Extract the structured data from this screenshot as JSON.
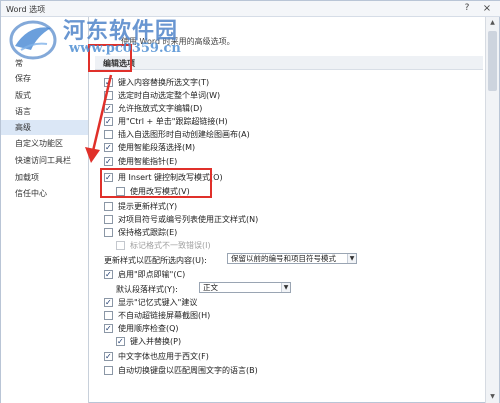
{
  "window": {
    "title": "Word 选项",
    "help_glyph": "?",
    "close_glyph": "×"
  },
  "sidebar": {
    "items": [
      {
        "label": "常"
      },
      {
        "label": "保存"
      },
      {
        "label": "版式"
      },
      {
        "label": "语言"
      },
      {
        "label": "高级",
        "selected": true
      },
      {
        "label": "自定义功能区"
      },
      {
        "label": "快速访问工具栏"
      },
      {
        "label": "加载项"
      },
      {
        "label": "信任中心"
      }
    ]
  },
  "content": {
    "intro": "使用 Word 时采用的高级选项。",
    "section_title": "编辑选项",
    "options": [
      {
        "label": "键入内容替换所选文字(T)",
        "checked": true
      },
      {
        "label": "选定时自动选定整个单词(W)",
        "checked": false
      },
      {
        "label": "允许拖放式文字编辑(D)",
        "checked": true
      },
      {
        "label": "用\"Ctrl + 单击\"跟踪超链接(H)",
        "checked": true
      },
      {
        "label": "插入自选图形时自动创建绘图画布(A)",
        "checked": false
      },
      {
        "label": "使用智能段落选择(M)",
        "checked": true
      },
      {
        "label": "使用智能指针(E)",
        "checked": true
      },
      {
        "label": "用 Insert 键控制改写模式(O)",
        "checked": true
      },
      {
        "label": "使用改写模式(V)",
        "checked": false,
        "indent": true
      },
      {
        "label": "提示更新样式(Y)",
        "checked": false
      },
      {
        "label": "对项目符号或编号列表使用正文样式(N)",
        "checked": false
      },
      {
        "label": "保持格式跟踪(E)",
        "checked": false
      },
      {
        "label": "标记格式不一致错误(I)",
        "checked": false,
        "indent": true,
        "disabled": true
      }
    ],
    "paste_style_label": "更新样式以匹配所选内容(U):",
    "paste_style_value": "保留以前的编号和项目符号模式",
    "options2": [
      {
        "label": "启用\"即点即输\"(C)",
        "checked": true
      }
    ],
    "default_para_label": "默认段落样式(Y):",
    "default_para_value": "正文",
    "options3": [
      {
        "label": "显示\"记忆式键入\"建议",
        "checked": true
      },
      {
        "label": "不自动超链接屏幕截图(H)",
        "checked": false
      },
      {
        "label": "使用顺序检查(Q)",
        "checked": true
      },
      {
        "label": "键入并替换(P)",
        "checked": true,
        "indent": true
      },
      {
        "label": "中文字体也应用于西文(F)",
        "checked": true
      },
      {
        "label": "自动切换键盘以匹配周围文字的语言(B)",
        "checked": false
      }
    ]
  },
  "watermark": {
    "title": "河东软件园",
    "url": "www.pc0359.cn"
  },
  "colors": {
    "annotation_red": "#e0302a",
    "selected_bg": "#dbe7f6",
    "watermark_blue": "#4f84c9"
  }
}
